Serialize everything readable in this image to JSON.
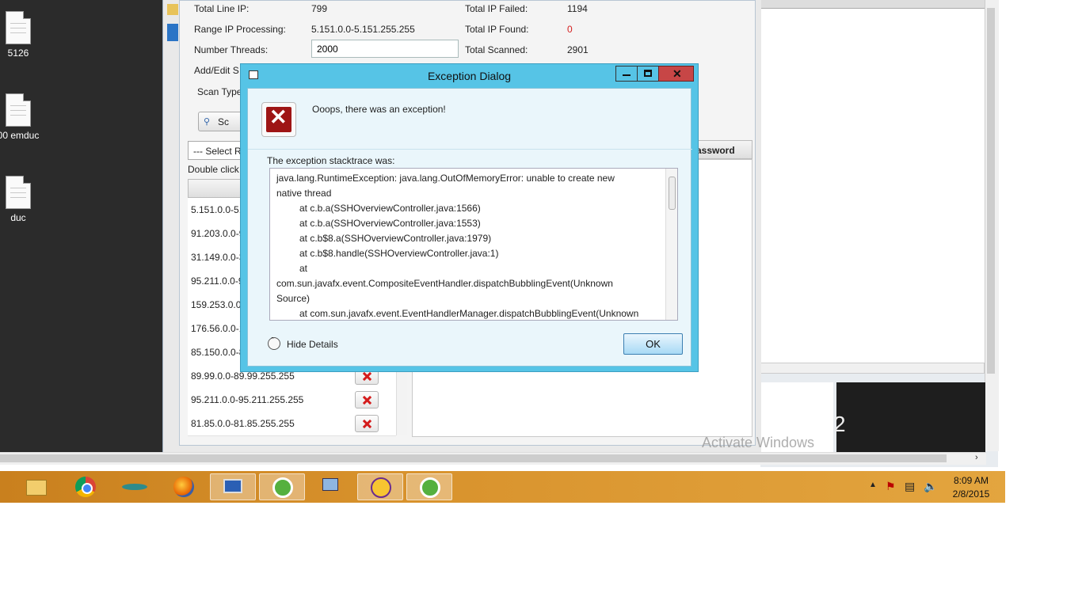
{
  "desktop": {
    "icons": [
      {
        "label": "5126"
      },
      {
        "label": "00 emduc"
      },
      {
        "label": "duc"
      }
    ]
  },
  "scanner": {
    "total_line_ip_label": "Total Line IP:",
    "total_line_ip_value": "799",
    "range_ip_label": "Range IP Processing:",
    "range_ip_value": "5.151.0.0-5.151.255.255",
    "threads_label": "Number Threads:",
    "threads_value": "2000",
    "add_edit_label": "Add/Edit S",
    "scan_type_label": "Scan Type",
    "total_failed_label": "Total IP Failed:",
    "total_failed_value": "1194",
    "total_found_label": "Total IP Found:",
    "total_found_value": "0",
    "total_scanned_label": "Total Scanned:",
    "total_scanned_value": "2901",
    "scan_button_label": "Sc",
    "select_dropdown_label": "--- Select R",
    "double_click_hint": "Double click",
    "column_password": "assword",
    "ranges": [
      {
        "text": "5.151.0.0-5."
      },
      {
        "text": "91.203.0.0-9"
      },
      {
        "text": "31.149.0.0-3"
      },
      {
        "text": "95.211.0.0-9"
      },
      {
        "text": "159.253.0.0-"
      },
      {
        "text": "176.56.0.0-1"
      },
      {
        "text": "85.150.0.0-8"
      },
      {
        "text": "89.99.0.0-89.99.255.255"
      },
      {
        "text": "95.211.0.0-95.211.255.255"
      },
      {
        "text": "81.85.0.0-81.85.255.255"
      }
    ],
    "found_color": "#d42020"
  },
  "dialog": {
    "title": "Exception Dialog",
    "header": "Ooops, there was an exception!",
    "trace_label": "The exception stacktrace was:",
    "trace_lines": [
      "java.lang.RuntimeException: java.lang.OutOfMemoryError: unable to create new",
      "native thread",
      "        at c.b.a(SSHOverviewController.java:1566)",
      "        at c.b.a(SSHOverviewController.java:1553)",
      "        at c.b$8.a(SSHOverviewController.java:1979)",
      "        at c.b$8.handle(SSHOverviewController.java:1)",
      "        at",
      "com.sun.javafx.event.CompositeEventHandler.dispatchBubblingEvent(Unknown",
      "Source)",
      "        at com.sun.javafx.event.EventHandlerManager.dispatchBubblingEvent(Unknown"
    ],
    "hide_details": "Hide Details",
    "ok": "OK"
  },
  "background": {
    "watermark": "Activate Windows",
    "number": "2"
  },
  "taskbar": {
    "time": "8:09 AM",
    "date": "2/8/2015",
    "apps": [
      "file-explorer-icon",
      "chrome-icon",
      "vietnam-airlines-icon",
      "firefox-icon",
      "remote-desktop-icon",
      "coccoc-icon",
      "network-computers-icon",
      "yahoo-messenger-icon",
      "coccoc-icon"
    ]
  }
}
